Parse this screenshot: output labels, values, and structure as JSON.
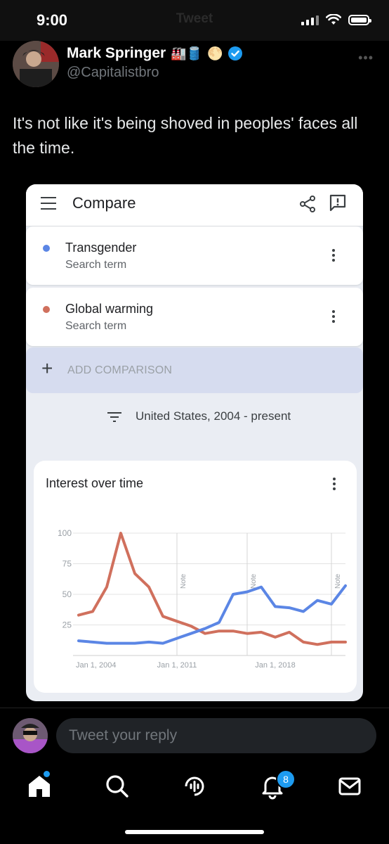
{
  "status": {
    "time": "9:00",
    "title": "Tweet"
  },
  "author": {
    "name": "Mark Springer",
    "handle": "@Capitalistbro",
    "badge_emojis": "🏭🛢️",
    "coin_emoji": "🌕"
  },
  "tweet": {
    "text": "It's not like it's being shoved in peoples' faces all the time."
  },
  "card": {
    "header_title": "Compare",
    "terms": [
      {
        "name": "Transgender",
        "sub": "Search term",
        "color": "#5b86e5"
      },
      {
        "name": "Global warming",
        "sub": "Search term",
        "color": "#d0705d"
      }
    ],
    "add_comparison": "ADD COMPARISON",
    "filter_text": "United States, 2004 - present",
    "chart_title": "Interest over time"
  },
  "chart_data": {
    "type": "line",
    "title": "Interest over time",
    "xlabel": "",
    "ylabel": "",
    "ylim": [
      0,
      100
    ],
    "y_ticks": [
      "100",
      "75",
      "50",
      "25"
    ],
    "x_tick_labels": [
      "Jan 1, 2004",
      "Jan 1, 2011",
      "Jan 1, 2018"
    ],
    "x": [
      2004.0,
      2005.0,
      2006.0,
      2007.0,
      2008.0,
      2009.0,
      2010.0,
      2011.0,
      2012.0,
      2013.0,
      2014.0,
      2015.0,
      2016.0,
      2017.0,
      2018.0,
      2019.0,
      2020.0,
      2021.0,
      2022.0,
      2023.0
    ],
    "xlim": [
      2004.0,
      2023.0
    ],
    "series": [
      {
        "name": "Transgender",
        "color": "#5b86e5",
        "values": [
          12,
          11,
          10,
          10,
          10,
          11,
          10,
          14,
          18,
          22,
          27,
          50,
          52,
          56,
          40,
          39,
          36,
          45,
          42,
          57
        ]
      },
      {
        "name": "Global warming",
        "color": "#d0705d",
        "values": [
          33,
          36,
          56,
          100,
          67,
          56,
          32,
          28,
          24,
          18,
          20,
          20,
          18,
          19,
          15,
          19,
          11,
          9,
          11,
          11
        ]
      }
    ],
    "notes": [
      "Note",
      "Note",
      "Note"
    ],
    "note_x": [
      2011.0,
      2016.0,
      2022.0
    ]
  },
  "reply": {
    "placeholder": "Tweet your reply"
  },
  "tabbar": {
    "notif_count": "8"
  }
}
